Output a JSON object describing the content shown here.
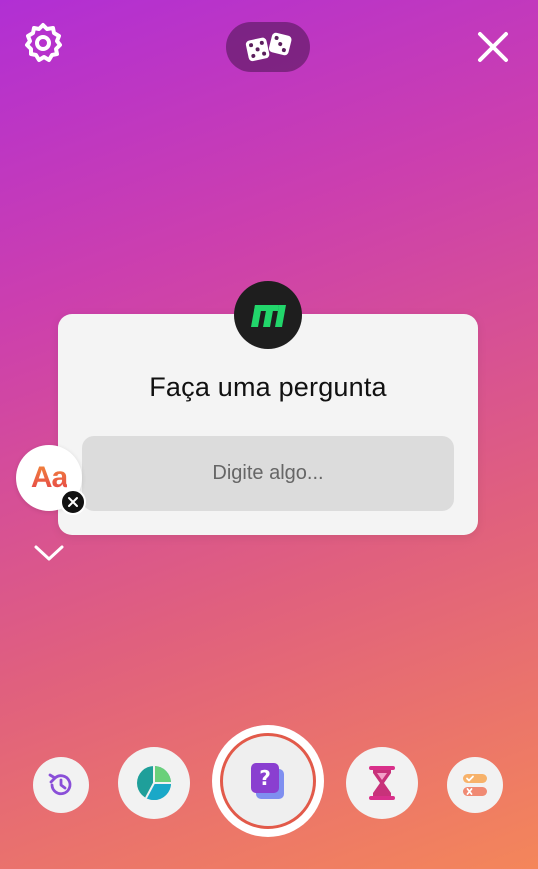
{
  "top_bar": {
    "settings_icon": "gear-icon",
    "center_icon": "dice-icon",
    "close_icon": "close-icon"
  },
  "question_sticker": {
    "avatar_icon": "brand-logo-icon",
    "title": "Faça uma pergunta",
    "input_placeholder": "Digite algo..."
  },
  "text_sticker": {
    "label": "Aa",
    "remove_icon": "close-icon"
  },
  "tray": {
    "items": [
      {
        "icon": "history-icon"
      },
      {
        "icon": "poll-pie-icon"
      },
      {
        "icon": "question-sticker-icon",
        "selected": true
      },
      {
        "icon": "hourglass-icon"
      },
      {
        "icon": "quiz-toggle-icon"
      }
    ]
  },
  "colors": {
    "gradient_start": "#b12fd4",
    "gradient_end": "#f4865a",
    "accent_ring": "#e25a4a",
    "avatar_bg": "#1e1e1e",
    "brand_green": "#22d66b",
    "card_bg": "#f4f4f4"
  }
}
